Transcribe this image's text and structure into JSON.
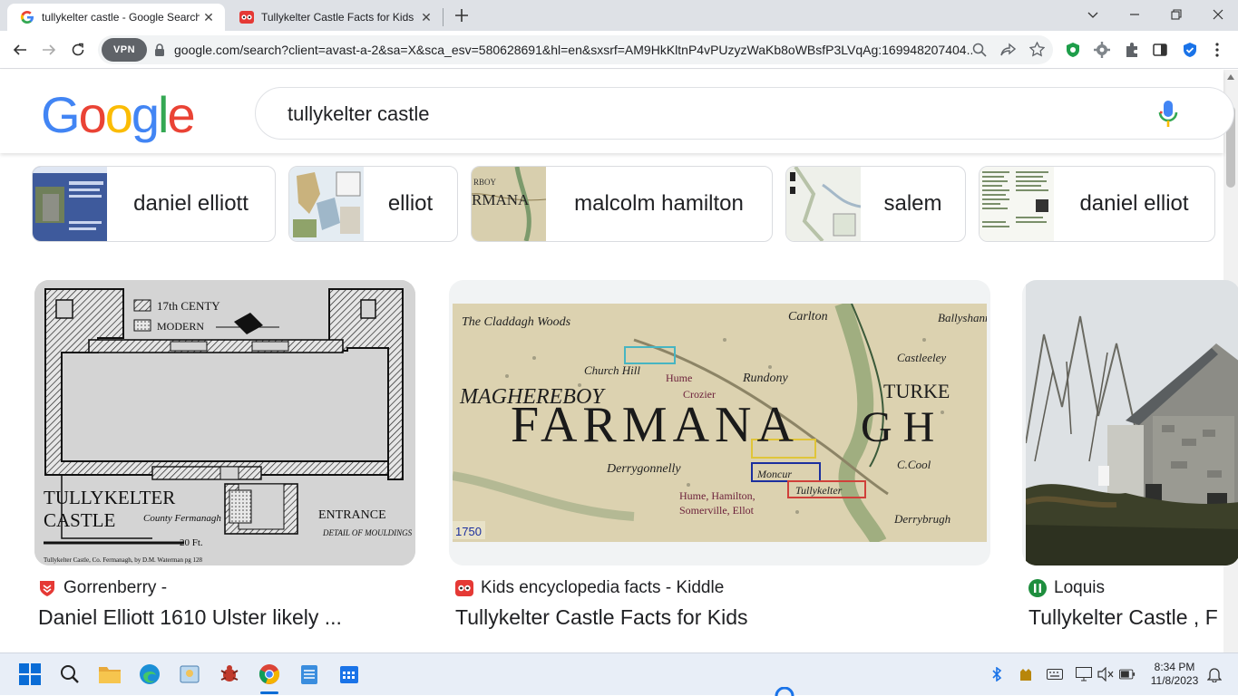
{
  "browser": {
    "tabs": [
      {
        "title": "tullykelter castle - Google Search",
        "active": true,
        "favicon": "google-g-icon"
      },
      {
        "title": "Tullykelter Castle Facts for Kids",
        "active": false,
        "favicon": "kiddle-icon"
      }
    ],
    "vpn_label": "VPN",
    "url": "google.com/search?client=avast-a-2&sa=X&sca_esv=580628691&hl=en&sxsrf=AM9HkKltnP4vPUzyzWaKb8oWBsfP3LVqAg:169948207404..."
  },
  "google": {
    "logo_letters": [
      {
        "ch": "G",
        "color": "#4285F4"
      },
      {
        "ch": "o",
        "color": "#EA4335"
      },
      {
        "ch": "o",
        "color": "#FBBC05"
      },
      {
        "ch": "g",
        "color": "#4285F4"
      },
      {
        "ch": "l",
        "color": "#34A853"
      },
      {
        "ch": "e",
        "color": "#EA4335"
      }
    ],
    "query": "tullykelter castle"
  },
  "chips": [
    {
      "label": "daniel elliott"
    },
    {
      "label": "elliot"
    },
    {
      "label": "malcolm hamilton"
    },
    {
      "label": "salem"
    },
    {
      "label": "daniel elliot"
    }
  ],
  "results": [
    {
      "source": "Gorrenberry -",
      "title": "Daniel Elliott 1610 Ulster likely ...",
      "plan": {
        "legend_old": "17th CENTY",
        "legend_new": "MODERN",
        "name_line1": "TULLYKELTER",
        "name_line2": "CASTLE",
        "county": "County Fermanagh",
        "entrance": "ENTRANCE",
        "detail": "DETAIL OF MOULDINGS",
        "scale_label": "20 Ft.",
        "caption": "Tullykelter Castle, Co. Fermanagh, by D.M. Waterman pg 128"
      }
    },
    {
      "source": "Kids encyclopedia facts - Kiddle",
      "title": "Tullykelter Castle Facts for Kids",
      "map": {
        "big_word": "FARMANA",
        "region_left": "MAGHEREBOY",
        "region_right": "TURKE",
        "places": [
          "The Claddagh Woods",
          "Church Hill",
          "Hume",
          "Crozier",
          "Derrygonnelly",
          "Hume, Hamilton,",
          "Somerville, Ellot",
          "Moncur",
          "Tullykelter",
          "Carlton",
          "Rundony",
          "Castleeley",
          "C.Cool",
          "Derrybrugh",
          "Ballyshannon"
        ],
        "year": "1750"
      }
    },
    {
      "source": "Loquis",
      "title": "Tullykelter Castle , F"
    }
  ],
  "taskbar": {
    "time": "8:34 PM",
    "date": "11/8/2023"
  }
}
